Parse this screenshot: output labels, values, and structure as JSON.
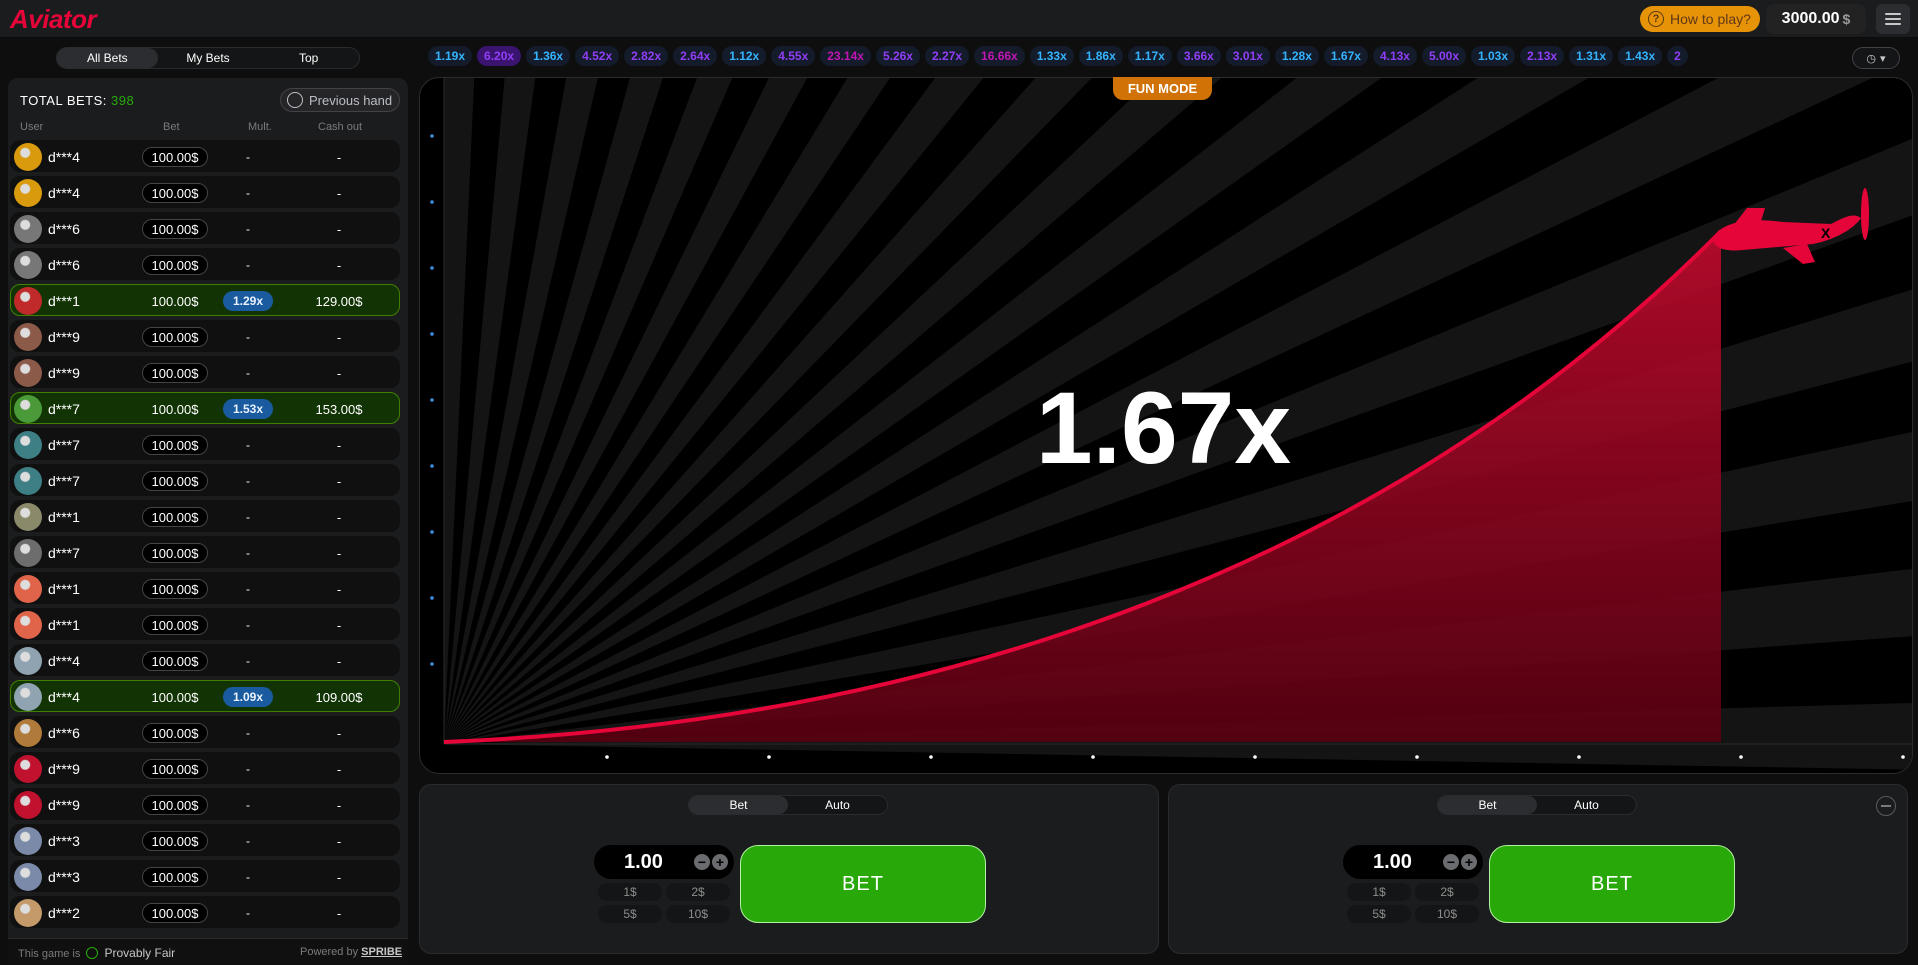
{
  "header": {
    "logo": "Aviator",
    "how_to_play": "How to play?",
    "balance_value": "3000.00",
    "balance_currency": "$",
    "menu_icon": "hamburger-icon"
  },
  "bet_tabs": [
    "All Bets",
    "My Bets",
    "Top"
  ],
  "panel": {
    "total_label": "TOTAL BETS:",
    "total_count": "398",
    "previous_hand": "Previous hand",
    "col_user": "User",
    "col_bet": "Bet",
    "col_mult": "Mult.",
    "col_cashout": "Cash out"
  },
  "bets": [
    {
      "user": "d***4",
      "bet": "100.00$",
      "mult": "-",
      "cashout": "-",
      "win": false,
      "avatar_color": "#d99a0e"
    },
    {
      "user": "d***4",
      "bet": "100.00$",
      "mult": "-",
      "cashout": "-",
      "win": false,
      "avatar_color": "#d99a0e"
    },
    {
      "user": "d***6",
      "bet": "100.00$",
      "mult": "-",
      "cashout": "-",
      "win": false,
      "avatar_color": "#777777"
    },
    {
      "user": "d***6",
      "bet": "100.00$",
      "mult": "-",
      "cashout": "-",
      "win": false,
      "avatar_color": "#777777"
    },
    {
      "user": "d***1",
      "bet": "100.00$",
      "mult": "1.29x",
      "cashout": "129.00$",
      "win": true,
      "avatar_color": "#c02a2a"
    },
    {
      "user": "d***9",
      "bet": "100.00$",
      "mult": "-",
      "cashout": "-",
      "win": false,
      "avatar_color": "#8c5a48"
    },
    {
      "user": "d***9",
      "bet": "100.00$",
      "mult": "-",
      "cashout": "-",
      "win": false,
      "avatar_color": "#8c5a48"
    },
    {
      "user": "d***7",
      "bet": "100.00$",
      "mult": "1.53x",
      "cashout": "153.00$",
      "win": true,
      "avatar_color": "#4a9a3a"
    },
    {
      "user": "d***7",
      "bet": "100.00$",
      "mult": "-",
      "cashout": "-",
      "win": false,
      "avatar_color": "#3e7f86"
    },
    {
      "user": "d***7",
      "bet": "100.00$",
      "mult": "-",
      "cashout": "-",
      "win": false,
      "avatar_color": "#3e7f86"
    },
    {
      "user": "d***1",
      "bet": "100.00$",
      "mult": "-",
      "cashout": "-",
      "win": false,
      "avatar_color": "#8a8a6a"
    },
    {
      "user": "d***7",
      "bet": "100.00$",
      "mult": "-",
      "cashout": "-",
      "win": false,
      "avatar_color": "#6d6d6d"
    },
    {
      "user": "d***1",
      "bet": "100.00$",
      "mult": "-",
      "cashout": "-",
      "win": false,
      "avatar_color": "#e0644a"
    },
    {
      "user": "d***1",
      "bet": "100.00$",
      "mult": "-",
      "cashout": "-",
      "win": false,
      "avatar_color": "#e0644a"
    },
    {
      "user": "d***4",
      "bet": "100.00$",
      "mult": "-",
      "cashout": "-",
      "win": false,
      "avatar_color": "#8fa4b0"
    },
    {
      "user": "d***4",
      "bet": "100.00$",
      "mult": "1.09x",
      "cashout": "109.00$",
      "win": true,
      "avatar_color": "#8fa4b0"
    },
    {
      "user": "d***6",
      "bet": "100.00$",
      "mult": "-",
      "cashout": "-",
      "win": false,
      "avatar_color": "#b07a3a"
    },
    {
      "user": "d***9",
      "bet": "100.00$",
      "mult": "-",
      "cashout": "-",
      "win": false,
      "avatar_color": "#c0122f"
    },
    {
      "user": "d***9",
      "bet": "100.00$",
      "mult": "-",
      "cashout": "-",
      "win": false,
      "avatar_color": "#c0122f"
    },
    {
      "user": "d***3",
      "bet": "100.00$",
      "mult": "-",
      "cashout": "-",
      "win": false,
      "avatar_color": "#7a8aa8"
    },
    {
      "user": "d***3",
      "bet": "100.00$",
      "mult": "-",
      "cashout": "-",
      "win": false,
      "avatar_color": "#7a8aa8"
    },
    {
      "user": "d***2",
      "bet": "100.00$",
      "mult": "-",
      "cashout": "-",
      "win": false,
      "avatar_color": "#c49a6a"
    }
  ],
  "footer": {
    "fair_prefix": "This game is",
    "fair_label": "Provably Fair",
    "powered_prefix": "Powered by",
    "powered_brand": "SPRIBE"
  },
  "history": [
    {
      "v": "1.19x",
      "c": "#34b4ff"
    },
    {
      "v": "6.20x",
      "c": "#913ef8",
      "bg": "#3b1470"
    },
    {
      "v": "1.36x",
      "c": "#34b4ff"
    },
    {
      "v": "4.52x",
      "c": "#913ef8"
    },
    {
      "v": "2.82x",
      "c": "#913ef8"
    },
    {
      "v": "2.64x",
      "c": "#913ef8"
    },
    {
      "v": "1.12x",
      "c": "#34b4ff"
    },
    {
      "v": "4.55x",
      "c": "#913ef8"
    },
    {
      "v": "23.14x",
      "c": "#c017b4"
    },
    {
      "v": "5.26x",
      "c": "#913ef8"
    },
    {
      "v": "2.27x",
      "c": "#913ef8"
    },
    {
      "v": "16.66x",
      "c": "#c017b4"
    },
    {
      "v": "1.33x",
      "c": "#34b4ff"
    },
    {
      "v": "1.86x",
      "c": "#34b4ff"
    },
    {
      "v": "1.17x",
      "c": "#34b4ff"
    },
    {
      "v": "3.66x",
      "c": "#913ef8"
    },
    {
      "v": "3.01x",
      "c": "#913ef8"
    },
    {
      "v": "1.28x",
      "c": "#34b4ff"
    },
    {
      "v": "1.67x",
      "c": "#34b4ff"
    },
    {
      "v": "4.13x",
      "c": "#913ef8"
    },
    {
      "v": "5.00x",
      "c": "#913ef8"
    },
    {
      "v": "1.03x",
      "c": "#34b4ff"
    },
    {
      "v": "2.13x",
      "c": "#913ef8"
    },
    {
      "v": "1.31x",
      "c": "#34b4ff"
    },
    {
      "v": "1.43x",
      "c": "#34b4ff"
    },
    {
      "v": "2",
      "c": "#913ef8"
    }
  ],
  "game": {
    "fun_mode": "FUN MODE",
    "multiplier": "1.67x",
    "accent_color": "#e50539"
  },
  "bet_panels": [
    {
      "tab_bet": "Bet",
      "tab_auto": "Auto",
      "stake": "1.00",
      "quick": [
        "1$",
        "2$",
        "5$",
        "10$"
      ],
      "button": "BET"
    },
    {
      "tab_bet": "Bet",
      "tab_auto": "Auto",
      "stake": "1.00",
      "quick": [
        "1$",
        "2$",
        "5$",
        "10$"
      ],
      "button": "BET"
    }
  ]
}
